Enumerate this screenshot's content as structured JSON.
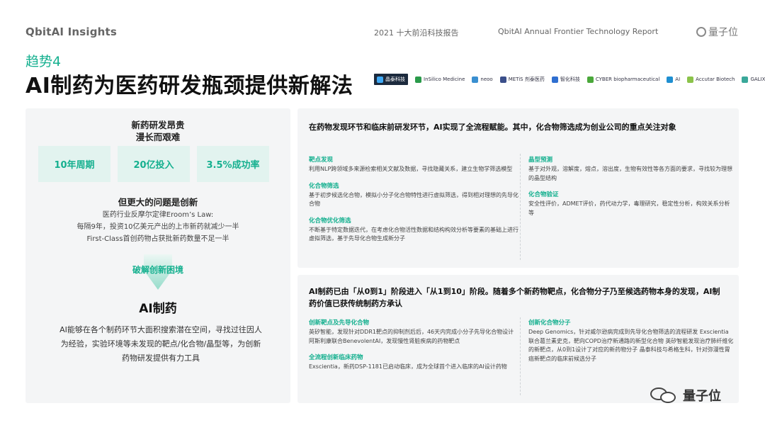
{
  "header": {
    "brand": "QbitAI Insights",
    "report_cn": "2021 十大前沿科技报告",
    "report_en": "QbitAI  Annual Frontier Technology Report",
    "logo_text": "量子位"
  },
  "trend_label": "趋势4",
  "title": "AI制药为医药研发瓶颈提供新解法",
  "partners": [
    {
      "name": "晶泰科技",
      "color": "#1c2a3d",
      "dark": true
    },
    {
      "name": "InSilico Medicine",
      "color": "#2a9a4a"
    },
    {
      "name": "neoo",
      "color": "#3a8fd0"
    },
    {
      "name": "METiS 剂泰医药",
      "color": "#3b4f8a"
    },
    {
      "name": "智化科技",
      "color": "#2f6fd0"
    },
    {
      "name": "CYBER biopharmaceutical",
      "color": "#4aa83a"
    },
    {
      "name": "AI",
      "color": "#1f8fd1"
    },
    {
      "name": "Accutar Biotech",
      "color": "#8bc34a"
    },
    {
      "name": "GALIXIR 望石",
      "color": "#3aa89a"
    }
  ],
  "left": {
    "heading_line1": "新药研发昂贵",
    "heading_line2": "漫长而艰难",
    "stats": [
      "10年周期",
      "20亿投入",
      "3.5%成功率"
    ],
    "sub_heading": "但更大的问题是创新",
    "note_line1": "医药行业反摩尔定律Eroom’s Law:",
    "note_line2": "每隔9年，投资10亿美元产出的上市新药就减少一半",
    "note_line3": "First-Class首创药物占获批新药数量不足一半",
    "breakthrough": "破解创新困境",
    "ai_title": "AI制药",
    "ai_desc": "AI能够在各个制药环节大面积搜索潜在空间，寻找过往因人为经验，实验环境等未发现的靶点/化合物/晶型等，为创新药物研发提供有力工具"
  },
  "top_panel": {
    "lead": "在药物发现环节和临床前研发环节，AI实现了全流程赋能。其中，化合物筛选成为创业公司的重点关注对象",
    "left_items": [
      {
        "title": "靶点发现",
        "text": "利用NLP跨领域多来源检索相关文献及数据，寻找隐藏关系，建立生物学筛选模型"
      },
      {
        "title": "化合物筛选",
        "text": "基于初步候选化合物，模拟小分子化合物特性进行虚拟筛选，得到相对理想的先导化合物"
      },
      {
        "title": "化合物优化筛选",
        "text": "不断基于特定数据迭代，在考虑化合物活性数据和结构构效分析等要素的基础上进行虚拟筛选，基于先导化合物生成新分子"
      }
    ],
    "right_items": [
      {
        "title": "晶型预测",
        "text": "基于对外观，溶解度，熔点，溶出度，生物有效性等各方面的要求，寻找较为理想的晶型结构"
      },
      {
        "title": "化合物验证",
        "text": "安全性评价，ADMET评价，药代动力学，毒理研究，稳定性分析，构效关系分析等"
      }
    ]
  },
  "bottom_panel": {
    "lead": "AI制药已由「从0到1」阶段进入「从1到10」阶段。随着多个新药物靶点，化合物分子乃至候选药物本身的发现，AI制药价值已获传统制药方承认",
    "left_items": [
      {
        "title": "创新靶点及先导化合物",
        "text": "英矽智能，发现针对DDR1靶点的抑制剂后后，46天内完成小分子先导化合物设计 阿斯利康联合BenevolentAI，发现慢性肾脏疾病的药物靶点"
      },
      {
        "title": "全流程创新临床药物",
        "text": "Exscientia，新药DSP-1181已启动临床，成为全球首个进入临床的AI设计药物"
      }
    ],
    "right_items": [
      {
        "title": "创新化合物分子",
        "text": "Deep Genomics，针对威尔逊病完成到先导化合物筛选的流程研发 Exscientia联合葛兰素史克，靶向COPD治疗新通路的新型化合物 英矽智能发现治疗肺纤维化的新靶点，从0到1设计了对应的新药物分子 晶泰科技与希格生科，针对弥漫性胃癌新靶点的临床前候选分子"
      }
    ]
  },
  "watermark": {
    "text": "量子位"
  },
  "colors": {
    "accent": "#15b08f",
    "panel_bg": "#f4f5f6",
    "stat_bg": "#e2f3ef"
  }
}
